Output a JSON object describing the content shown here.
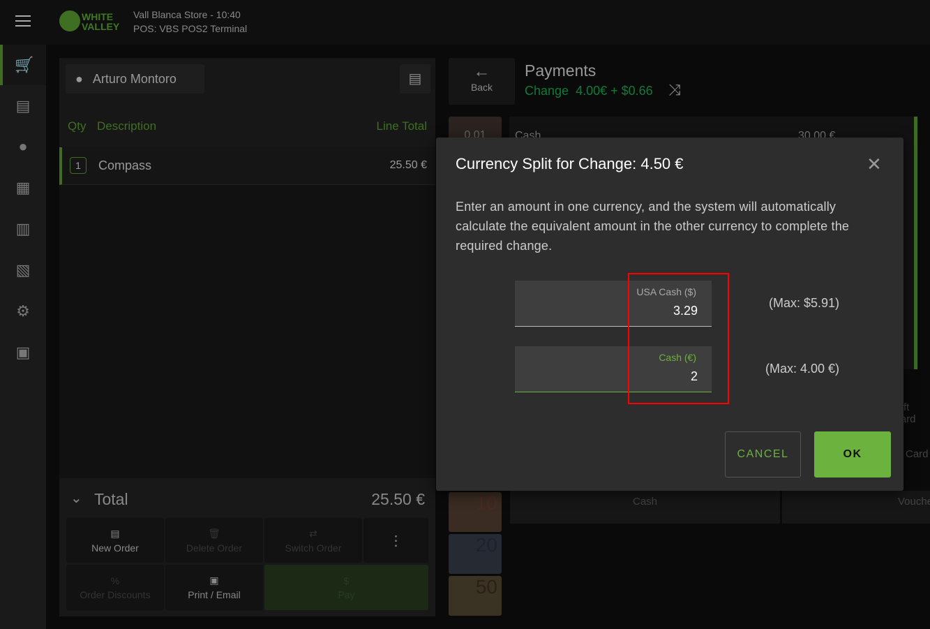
{
  "header": {
    "store": "Vall Blanca Store - 10:40",
    "terminal": "POS: VBS POS2 Terminal",
    "logo_text": "WHITE VALLEY"
  },
  "sidebar": {
    "items": [
      "cart-icon",
      "orders-icon",
      "customer-icon",
      "register-icon",
      "store-icon",
      "reports-icon",
      "settings-icon",
      "printer-icon"
    ]
  },
  "order": {
    "customer": "Arturo Montoro",
    "columns": {
      "qty": "Qty",
      "description": "Description",
      "line_total": "Line Total"
    },
    "lines": [
      {
        "qty": "1",
        "description": "Compass",
        "total": "25.50 €"
      }
    ],
    "total_label": "Total",
    "total_value": "25.50 €",
    "actions": {
      "new_order": "New Order",
      "delete_order": "Delete Order",
      "switch_order": "Switch Order",
      "order_discounts": "Order Discounts",
      "print_email": "Print / Email",
      "pay": "Pay"
    }
  },
  "payments": {
    "back": "Back",
    "title": "Payments",
    "change_label": "Change",
    "change_value": "4.00€ + $0.66",
    "cash_row": {
      "coin": "0.01",
      "label": "Cash",
      "amount": "30.00 €"
    },
    "methods": [
      "Gift Card",
      "Card",
      "Cash",
      "Voucher"
    ],
    "banknotes": [
      "10",
      "20",
      "50"
    ]
  },
  "dialog": {
    "title": "Currency Split for Change: 4.50 €",
    "body": "Enter an amount in one currency, and the system will automatically calculate the equivalent amount in the other currency to complete the required change.",
    "usd": {
      "label": "USA Cash ($)",
      "value": "3.29",
      "max": "(Max: $5.91)"
    },
    "eur": {
      "label": "Cash (€)",
      "value": "2",
      "max": "(Max: 4.00 €)"
    },
    "cancel": "CANCEL",
    "ok": "OK"
  },
  "colors": {
    "accent": "#6bb23f",
    "highlight": "#ff0000"
  }
}
